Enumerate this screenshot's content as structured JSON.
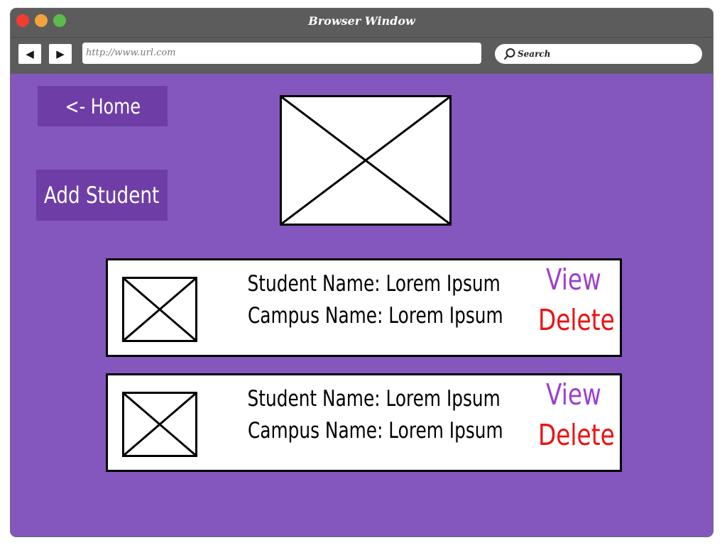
{
  "window": {
    "title": "Browser Window",
    "colors": {
      "titlebar": "#5c5c5c",
      "content_bg": "#8457be",
      "button_bg": "#6e3ea6",
      "view_link": "#9b3fd1",
      "delete_link": "#ee1111"
    }
  },
  "toolbar": {
    "back_icon": "back-arrow-icon",
    "forward_icon": "forward-arrow-icon",
    "url": "http://www.url.com",
    "search_placeholder": "Search",
    "search_icon": "search-icon"
  },
  "main": {
    "home_button": "<- Home",
    "add_button": "Add Student",
    "students": [
      {
        "name_line": "Student Name: Lorem Ipsum",
        "campus_line": "Campus Name: Lorem Ipsum",
        "view_label": "View",
        "delete_label": "Delete"
      },
      {
        "name_line": "Student Name: Lorem Ipsum",
        "campus_line": "Campus Name: Lorem Ipsum",
        "view_label": "View",
        "delete_label": "Delete"
      }
    ]
  }
}
